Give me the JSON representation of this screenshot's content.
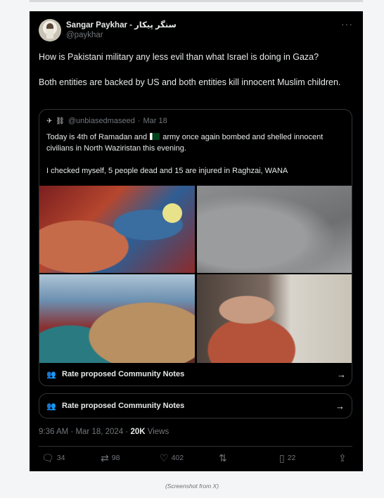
{
  "author": {
    "name": "Sangar Paykhar - سنگر پیکار",
    "handle": "@paykhar"
  },
  "tweet": {
    "text_1": "How is Pakistani military any less evil than what Israel is doing in Gaza?",
    "text_2": "Both entities are backed by US and both entities kill innocent Muslim children."
  },
  "quote": {
    "emoji_prefix": "✈ ⛓",
    "handle": "@unbiasedmaseed",
    "date": "Mar 18",
    "text_1a": "Today is 4th of Ramadan and",
    "text_1b": "army once again bombed and shelled innocent civilians in North Waziristan this evening.",
    "text_2": "I checked myself, 5 people dead and 15 are injured in Raghzai, WANA",
    "community_notes_label": "Rate proposed Community Notes"
  },
  "community_notes_label": "Rate proposed Community Notes",
  "meta": {
    "time": "9:36 AM",
    "date": "Mar 18, 2024",
    "views_count": "20K",
    "views_label": "Views"
  },
  "actions": {
    "replies": "34",
    "reposts": "98",
    "likes": "402",
    "bookmarks": "22"
  },
  "more_glyph": "···",
  "caption": "(Screenshot from X)",
  "icons": {
    "reply": "reply-icon",
    "repost": "repost-icon",
    "like": "heart-icon",
    "analytics": "analytics-icon",
    "bookmark": "bookmark-icon",
    "share": "share-icon",
    "community": "community-notes-icon",
    "arrow": "arrow-right-icon"
  },
  "colors": {
    "background": "#000000",
    "accent": "#1d9bf0",
    "muted": "#71767b"
  }
}
